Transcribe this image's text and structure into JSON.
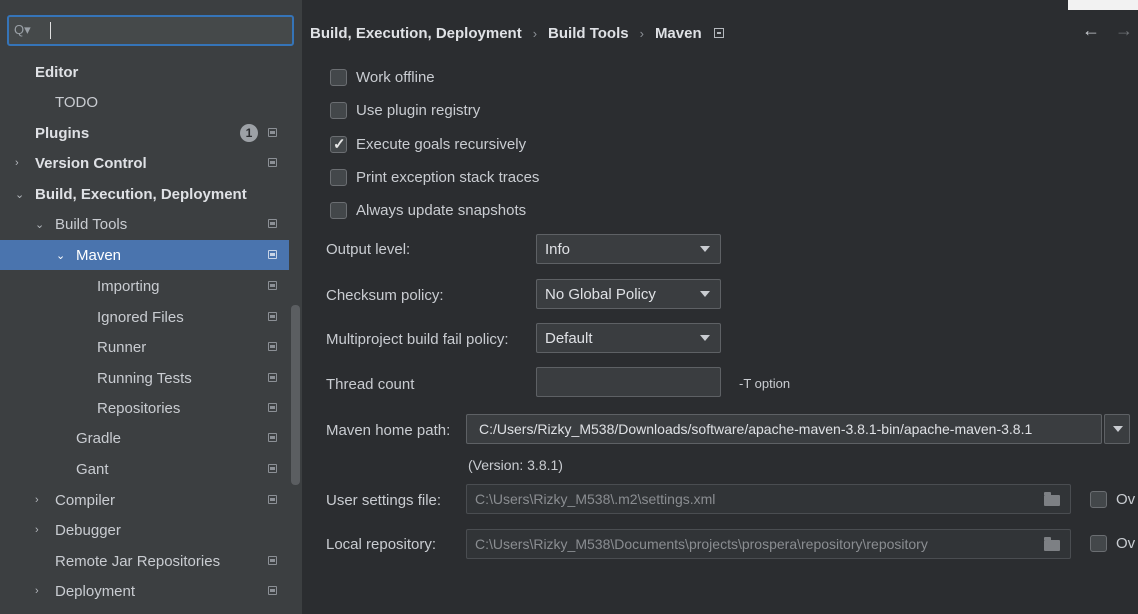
{
  "search": {
    "value": ""
  },
  "sidebar": {
    "items": [
      {
        "label": "Editor"
      },
      {
        "label": "TODO"
      },
      {
        "label": "Plugins",
        "badge": "1"
      },
      {
        "label": "Version Control"
      },
      {
        "label": "Build, Execution, Deployment"
      },
      {
        "label": "Build Tools"
      },
      {
        "label": "Maven"
      },
      {
        "label": "Importing"
      },
      {
        "label": "Ignored Files"
      },
      {
        "label": "Runner"
      },
      {
        "label": "Running Tests"
      },
      {
        "label": "Repositories"
      },
      {
        "label": "Gradle"
      },
      {
        "label": "Gant"
      },
      {
        "label": "Compiler"
      },
      {
        "label": "Debugger"
      },
      {
        "label": "Remote Jar Repositories"
      },
      {
        "label": "Deployment"
      }
    ]
  },
  "breadcrumb": {
    "items": [
      "Build, Execution, Deployment",
      "Build Tools",
      "Maven"
    ],
    "separator": "›"
  },
  "checkboxes": [
    {
      "label": "Work offline",
      "checked": false
    },
    {
      "label": "Use plugin registry",
      "checked": false
    },
    {
      "label": "Execute goals recursively",
      "checked": true
    },
    {
      "label": "Print exception stack traces",
      "checked": false
    },
    {
      "label": "Always update snapshots",
      "checked": false
    }
  ],
  "form": {
    "output_level": {
      "label": "Output level:",
      "value": "Info"
    },
    "checksum_policy": {
      "label": "Checksum policy:",
      "value": "No Global Policy"
    },
    "fail_policy": {
      "label": "Multiproject build fail policy:",
      "value": "Default"
    },
    "thread_count": {
      "label": "Thread count",
      "value": "",
      "hint": "-T option"
    },
    "maven_home": {
      "label": "Maven home path:",
      "value": "C:/Users/Rizky_M538/Downloads/software/apache-maven-3.8.1-bin/apache-maven-3.8.1",
      "version": "(Version: 3.8.1)"
    },
    "user_settings": {
      "label": "User settings file:",
      "value": "C:\\Users\\Rizky_M538\\.m2\\settings.xml",
      "override": "Ov"
    },
    "local_repo": {
      "label": "Local repository:",
      "value": "C:\\Users\\Rizky_M538\\Documents\\projects\\prospera\\repository\\repository",
      "override": "Ov"
    }
  },
  "icons": {
    "search": "magnifier-dropdown",
    "project_level": "window-icon",
    "back": "←",
    "forward": "→",
    "expanded": "⌄",
    "collapsed": "›"
  },
  "colors": {
    "accent": "#3574b8",
    "selection": "#4a74ae",
    "background": "#2b2d30",
    "sidebar": "#3c3f41"
  }
}
